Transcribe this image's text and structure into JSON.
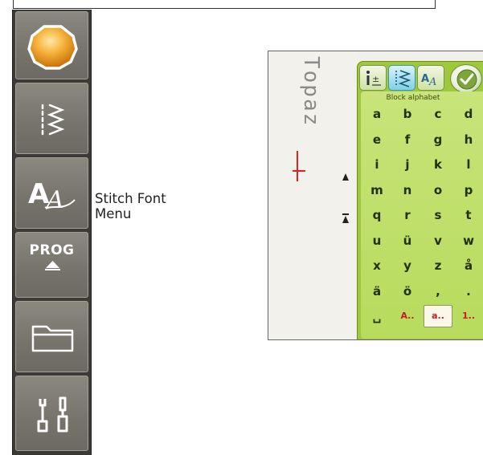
{
  "toolbar": {
    "buttons": [
      {
        "icon": "start-menu-icon"
      },
      {
        "icon": "stitch-menu-icon"
      },
      {
        "icon": "stitch-font-menu-icon"
      },
      {
        "icon": "program-icon",
        "label": "PROG"
      },
      {
        "icon": "file-manager-icon"
      },
      {
        "icon": "settings-tools-icon"
      }
    ]
  },
  "callout": {
    "line1": "Stitch Font",
    "line2": "Menu"
  },
  "screen": {
    "sewing_text": "Topaz",
    "panel": {
      "title": "Block alphabet",
      "rows": [
        [
          "a",
          "b",
          "c",
          "d"
        ],
        [
          "e",
          "f",
          "g",
          "h"
        ],
        [
          "i",
          "j",
          "k",
          "l"
        ],
        [
          "m",
          "n",
          "o",
          "p"
        ],
        [
          "q",
          "r",
          "s",
          "t"
        ],
        [
          "u",
          "ü",
          "v",
          "w"
        ],
        [
          "x",
          "y",
          "z",
          "å"
        ],
        [
          "ä",
          "ö",
          ",",
          "."
        ],
        [
          "␣",
          "A..",
          "a..",
          "1.."
        ]
      ]
    }
  },
  "colors": {
    "toolbar": "#3b3a36",
    "panel_green": "#9ec93a",
    "accent_orange": "#f0a020",
    "selected_blue": "#7fd0e8"
  }
}
